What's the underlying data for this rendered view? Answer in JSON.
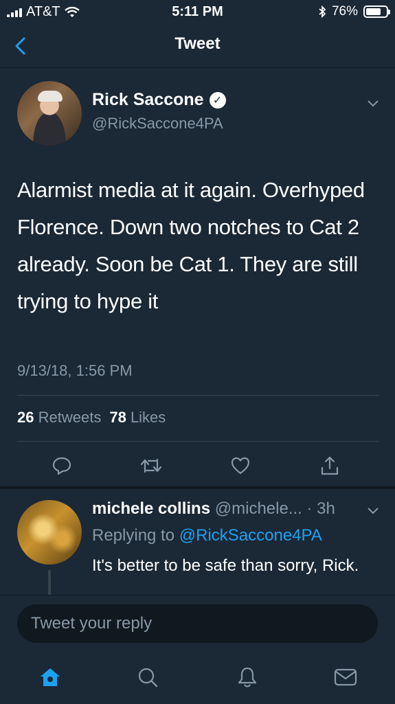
{
  "status_bar": {
    "carrier": "AT&T",
    "time": "5:11 PM",
    "battery": "76%",
    "battery_level": 0.76
  },
  "nav": {
    "title": "Tweet"
  },
  "tweet": {
    "author_name": "Rick Saccone",
    "handle": "@RickSaccone4PA",
    "text": "Alarmist media at it again. Overhyped Florence. Down two notches to Cat 2 already. Soon be Cat 1. They are still trying to hype it",
    "timestamp": "9/13/18, 1:56 PM",
    "retweets_count": "26",
    "retweets_label": "Retweets",
    "likes_count": "78",
    "likes_label": "Likes"
  },
  "reply": {
    "name": "michele collins",
    "handle": "@michele...",
    "time": "· 3h",
    "replying_prefix": "Replying to",
    "replying_to": "@RickSaccone4PA",
    "text": "It's better to be safe than sorry, Rick."
  },
  "composer": {
    "placeholder": "Tweet your reply"
  },
  "icons": {
    "reply": "comment-icon",
    "retweet": "retweet-icon",
    "like": "heart-icon",
    "share": "share-icon",
    "home": "home-icon",
    "search": "search-icon",
    "notifications": "bell-icon",
    "messages": "mail-icon"
  },
  "colors": {
    "background": "#1b2836",
    "accent": "#1da1f2",
    "secondary_text": "#8899a6"
  }
}
